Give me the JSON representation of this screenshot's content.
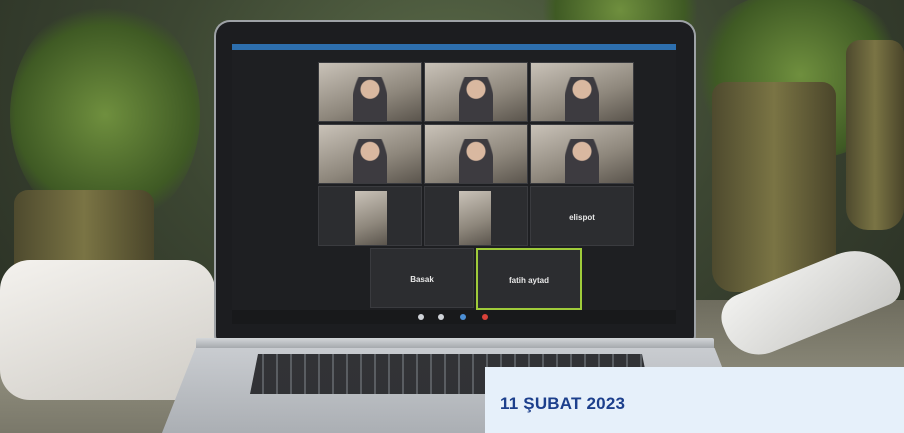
{
  "meeting": {
    "participants": [
      {
        "name": "",
        "video": true
      },
      {
        "name": "",
        "video": true
      },
      {
        "name": "",
        "video": true
      },
      {
        "name": "",
        "video": true
      },
      {
        "name": "",
        "video": true
      },
      {
        "name": "",
        "video": true
      },
      {
        "name": "",
        "video": true
      },
      {
        "name": "",
        "video": true
      },
      {
        "name": "elispot",
        "video": false
      },
      {
        "name": "Basak",
        "video": false
      },
      {
        "name": "fatih aytad",
        "video": false,
        "active": true
      }
    ]
  },
  "caption": {
    "date": "11 ŞUBAT 2023"
  },
  "colors": {
    "caption_bg": "#e6f0fa",
    "caption_text": "#1c3f8c",
    "active_speaker_border": "#9fcb3a"
  }
}
